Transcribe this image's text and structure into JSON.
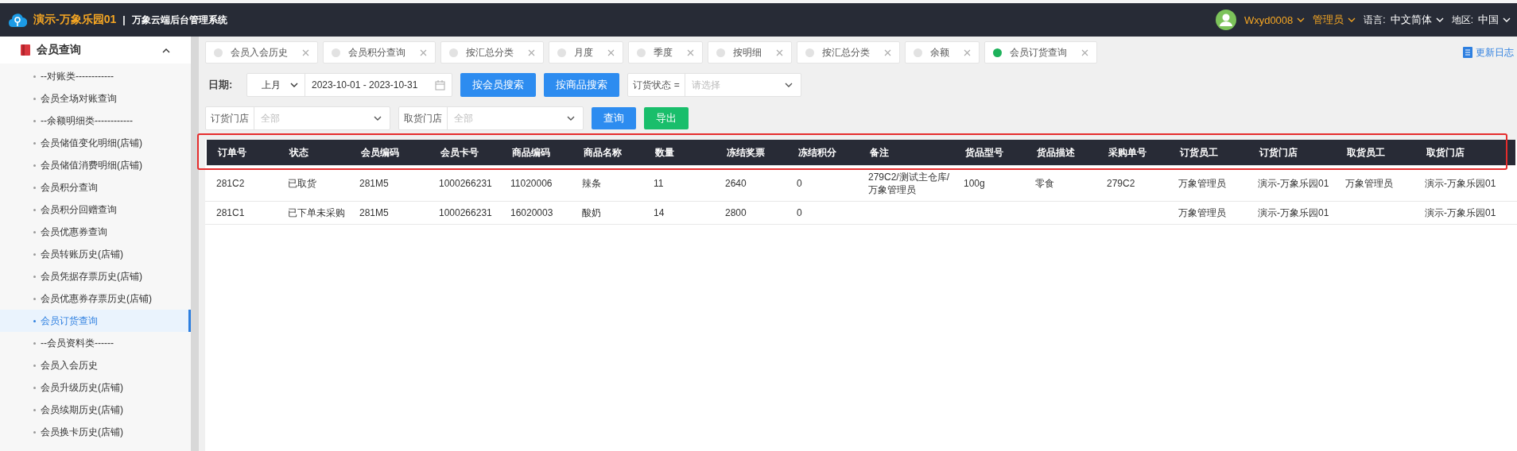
{
  "header": {
    "site_name": "演示-万象乐园01",
    "separator": "|",
    "system_name": "万象云端后台管理系统",
    "user": "Wxyd0008",
    "role": "管理员",
    "language_label": "语言:",
    "language": "中文简体",
    "region_label": "地区:",
    "region": "中国"
  },
  "sidebar": {
    "title": "会员查询",
    "expanded": true,
    "items": [
      {
        "label": "--对账类------------",
        "selected": false
      },
      {
        "label": "会员全场对账查询",
        "selected": false
      },
      {
        "label": "--余额明细类------------",
        "selected": false
      },
      {
        "label": "会员储值变化明细(店铺)",
        "selected": false
      },
      {
        "label": "会员储值消费明细(店铺)",
        "selected": false
      },
      {
        "label": "会员积分查询",
        "selected": false
      },
      {
        "label": "会员积分回赠查询",
        "selected": false
      },
      {
        "label": "会员优惠券查询",
        "selected": false
      },
      {
        "label": "会员转账历史(店铺)",
        "selected": false
      },
      {
        "label": "会员凭据存票历史(店铺)",
        "selected": false
      },
      {
        "label": "会员优惠券存票历史(店铺)",
        "selected": false
      },
      {
        "label": "会员订货查询",
        "selected": true
      },
      {
        "label": "--会员资料类------",
        "selected": false
      },
      {
        "label": "会员入会历史",
        "selected": false
      },
      {
        "label": "会员升级历史(店铺)",
        "selected": false
      },
      {
        "label": "会员续期历史(店铺)",
        "selected": false
      },
      {
        "label": "会员换卡历史(店铺)",
        "selected": false
      }
    ]
  },
  "tabs": [
    {
      "label": "会员入会历史",
      "selected": false
    },
    {
      "label": "会员积分查询",
      "selected": false
    },
    {
      "label": "按汇总分类",
      "selected": false
    },
    {
      "label": "月度",
      "selected": false
    },
    {
      "label": "季度",
      "selected": false
    },
    {
      "label": "按明细",
      "selected": false
    },
    {
      "label": "按汇总分类",
      "selected": false
    },
    {
      "label": "余额",
      "selected": false
    },
    {
      "label": "会员订货查询",
      "selected": true
    }
  ],
  "changelog_link": "更新日志",
  "filters": {
    "date_label": "日期:",
    "period": "上月",
    "date_range": "2023-10-01 - 2023-10-31",
    "member_search_button": "按会员搜索",
    "product_search_button": "按商品搜索",
    "status_label": "订货状态 =",
    "status_placeholder": "请选择",
    "order_store_label": "订货门店",
    "order_store_placeholder": "全部",
    "pickup_store_label": "取货门店",
    "pickup_store_placeholder": "全部",
    "query_button": "查询",
    "export_button": "导出"
  },
  "table": {
    "header_highlighted": true,
    "columns": [
      "订单号",
      "状态",
      "会员编码",
      "会员卡号",
      "商品编码",
      "商品名称",
      "数量",
      "冻结奖票",
      "冻结积分",
      "备注",
      "货品型号",
      "货品描述",
      "采购单号",
      "订货员工",
      "订货门店",
      "取货员工",
      "取货门店"
    ],
    "rows": [
      [
        "281C2",
        "已取货",
        "281M5",
        "1000266231",
        "11020006",
        "辣条",
        "11",
        "2640",
        "0",
        "279C2/测试主仓库/万象管理员",
        "100g",
        "零食",
        "279C2",
        "万象管理员",
        "演示-万象乐园01",
        "万象管理员",
        "演示-万象乐园01"
      ],
      [
        "281C1",
        "已下单未采购",
        "281M5",
        "1000266231",
        "16020003",
        "酸奶",
        "14",
        "2800",
        "0",
        "",
        "",
        "",
        "",
        "万象管理员",
        "演示-万象乐园01",
        "",
        "演示-万象乐园01"
      ]
    ]
  }
}
